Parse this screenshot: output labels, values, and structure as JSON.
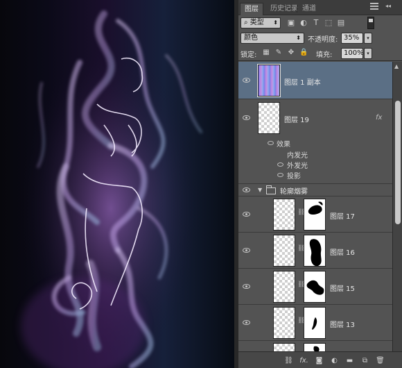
{
  "tabs": [
    {
      "label": "图层",
      "active": true
    },
    {
      "label": "历史记录",
      "active": false
    },
    {
      "label": "通道",
      "active": false
    }
  ],
  "filter": {
    "kind_label": "类型",
    "icons": [
      "image-icon",
      "adjustment-icon",
      "text-icon",
      "shape-icon",
      "smart-object-icon"
    ]
  },
  "blend": {
    "mode": "颜色",
    "opacity_label": "不透明度:",
    "opacity": "35%"
  },
  "lock": {
    "label": "锁定:",
    "fill_label": "填充:",
    "fill": "100%"
  },
  "layers": [
    {
      "name": "图层 1 副本",
      "thumb": "gradient",
      "selected": true
    },
    {
      "name": "图层 19",
      "thumb": "transparent",
      "fx": "fx",
      "effects_title": "效果",
      "effects": [
        "内发光",
        "外发光",
        "投影"
      ]
    },
    {
      "group": "轮廓烟雾"
    },
    {
      "name": "图层 17",
      "mask": "blob-top"
    },
    {
      "name": "图层 16",
      "mask": "blob-tall"
    },
    {
      "name": "图层 15",
      "mask": "blob-mid"
    },
    {
      "name": "图层 13",
      "mask": "blob-thin"
    }
  ],
  "bottom_icons": [
    "link-icon",
    "fx-icon",
    "mask-icon",
    "adjustment-layer-icon",
    "group-icon",
    "new-layer-icon",
    "trash-icon"
  ],
  "colors": {
    "selection": "#5b6f85",
    "panel": "#535353",
    "smoke_purple": "#c9a8f0",
    "smoke_blue": "#9fc4e8"
  }
}
